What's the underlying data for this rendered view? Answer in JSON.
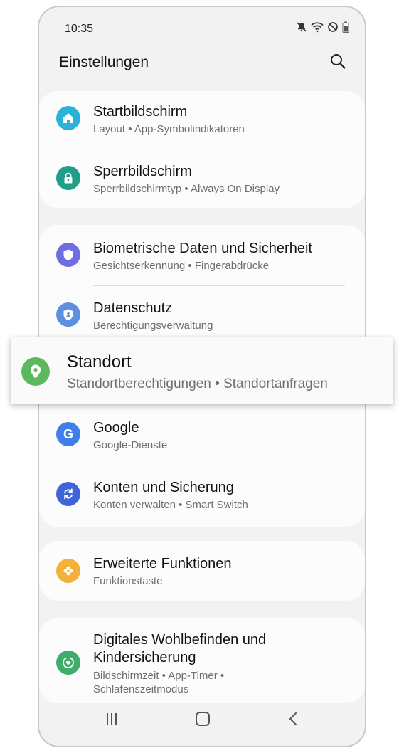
{
  "status_bar": {
    "time": "10:35",
    "icons": [
      "mute-icon",
      "wifi-icon",
      "do-not-disturb-icon",
      "battery-icon"
    ]
  },
  "header": {
    "title": "Einstellungen",
    "search_icon": "search-icon"
  },
  "settings": {
    "home_screen": {
      "title": "Startbildschirm",
      "subtitle": "Layout  •  App-Symbolindikatoren",
      "icon": "home-icon",
      "color": "#2ab3d6"
    },
    "lock_screen": {
      "title": "Sperrbildschirm",
      "subtitle": "Sperrbildschirmtyp  •  Always On Display",
      "icon": "lock-icon",
      "color": "#1f9e8a"
    },
    "biometrics": {
      "title": "Biometrische Daten und Sicherheit",
      "subtitle": "Gesichtserkennung  •  Fingerabdrücke",
      "icon": "shield-icon",
      "color": "#6f6ee0"
    },
    "privacy": {
      "title": "Datenschutz",
      "subtitle": "Berechtigungsverwaltung",
      "icon": "privacy-icon",
      "color": "#5f8fe0"
    },
    "location": {
      "title": "Standort",
      "subtitle": "Standortberechtigungen  •  Standortanfragen",
      "icon": "location-pin-icon",
      "color": "#5cb85c"
    },
    "google": {
      "title": "Google",
      "subtitle": "Google-Dienste",
      "icon": "google-icon",
      "color": "#3f7fe8"
    },
    "accounts": {
      "title": "Konten und Sicherung",
      "subtitle": "Konten verwalten  •  Smart Switch",
      "icon": "sync-icon",
      "color": "#3e64d8"
    },
    "advanced": {
      "title": "Erweiterte Funktionen",
      "subtitle": "Funktionstaste",
      "icon": "puzzle-icon",
      "color": "#f3b13b"
    },
    "wellbeing": {
      "title_line1": "Digitales Wohlbefinden und",
      "title_line2": "Kindersicherung",
      "subtitle_line1": "Bildschirmzeit  •  App-Timer  •",
      "subtitle_line2": "Schlafenszeitmodus",
      "icon": "wellbeing-icon",
      "color": "#3fae6a"
    }
  },
  "nav_bar": {
    "recents": "recents-icon",
    "home": "home-button-icon",
    "back": "back-icon"
  }
}
